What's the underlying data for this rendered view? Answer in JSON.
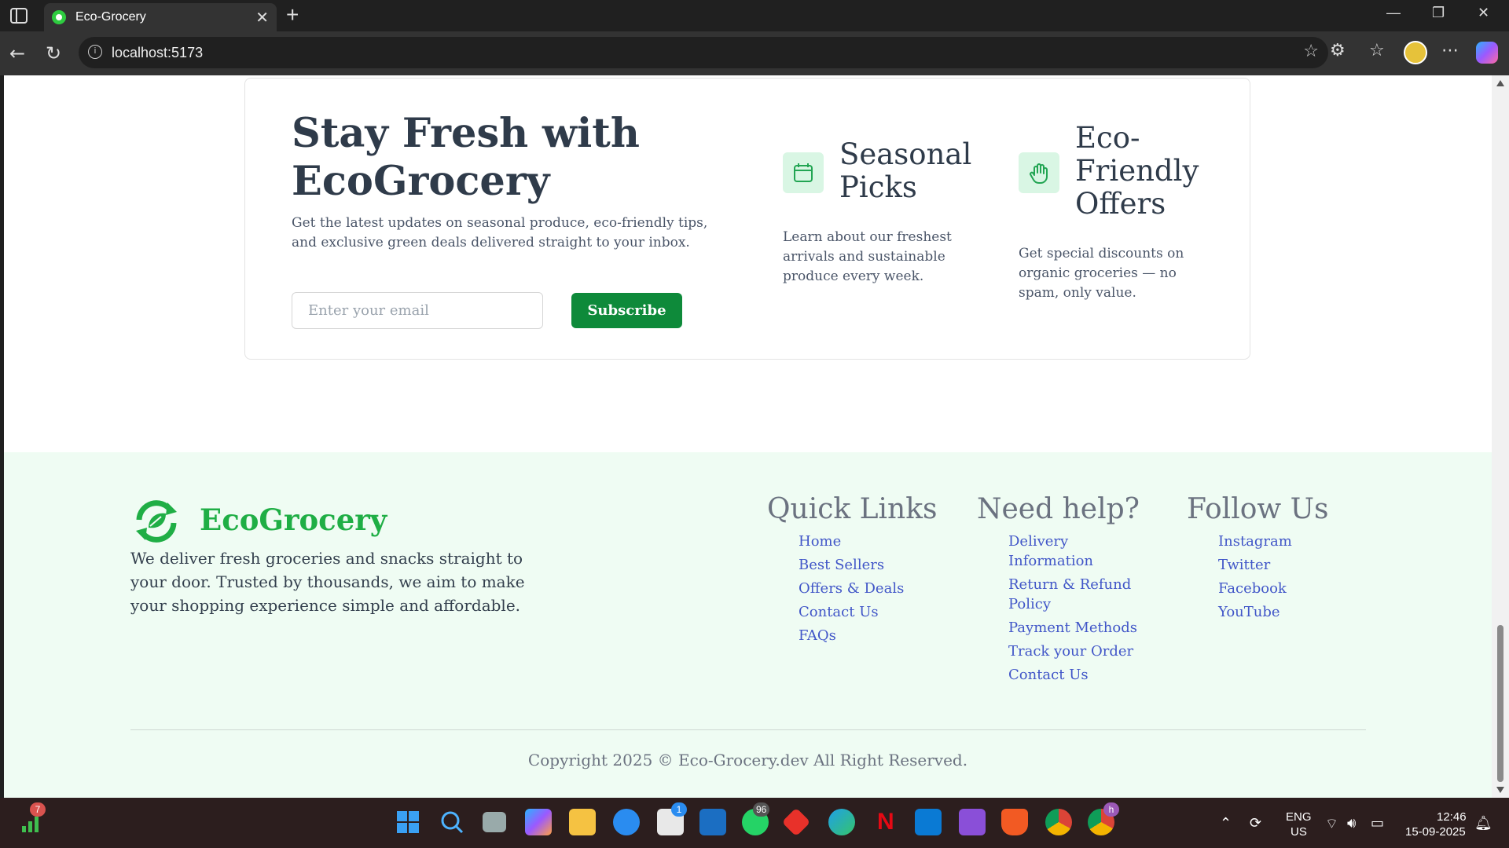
{
  "browser": {
    "tab_title": "Eco-Grocery",
    "url": "localhost:5173"
  },
  "newsletter": {
    "title": "Stay Fresh with EcoGrocery",
    "description": "Get the latest updates on seasonal produce, eco-friendly tips, and exclusive green deals delivered straight to your inbox.",
    "email_placeholder": "Enter your email",
    "subscribe_label": "Subscribe",
    "features": [
      {
        "icon": "calendar-icon",
        "title": "Seasonal Picks",
        "description": "Learn about our freshest arrivals and sustainable produce every week."
      },
      {
        "icon": "hand-icon",
        "title": "Eco-Friendly Offers",
        "description": "Get special discounts on organic groceries — no spam, only value."
      }
    ]
  },
  "footer": {
    "brand_name": "EcoGrocery",
    "brand_description": "We deliver fresh groceries and snacks straight to your door. Trusted by thousands, we aim to make your shopping experience simple and affordable.",
    "columns": [
      {
        "title": "Quick Links",
        "links": [
          "Home",
          "Best Sellers",
          "Offers & Deals",
          "Contact Us",
          "FAQs"
        ]
      },
      {
        "title": "Need help?",
        "links": [
          "Delivery Information",
          "Return & Refund Policy",
          "Payment Methods",
          "Track your Order",
          "Contact Us"
        ]
      },
      {
        "title": "Follow Us",
        "links": [
          "Instagram",
          "Twitter",
          "Facebook",
          "YouTube"
        ]
      }
    ],
    "copyright": "Copyright 2025 © Eco-Grocery.dev All Right Reserved."
  },
  "taskbar": {
    "widget_badge": "7",
    "whatsapp_badge": "96",
    "store_badge": "1",
    "chrome_badge": "h",
    "lang_top": "ENG",
    "lang_bottom": "US",
    "time": "12:46",
    "date": "15-09-2025"
  },
  "colors": {
    "brand_green": "#1fae45",
    "button_green": "#0e8a3a",
    "link_blue": "#4156c8",
    "footer_bg": "#effcf3"
  }
}
